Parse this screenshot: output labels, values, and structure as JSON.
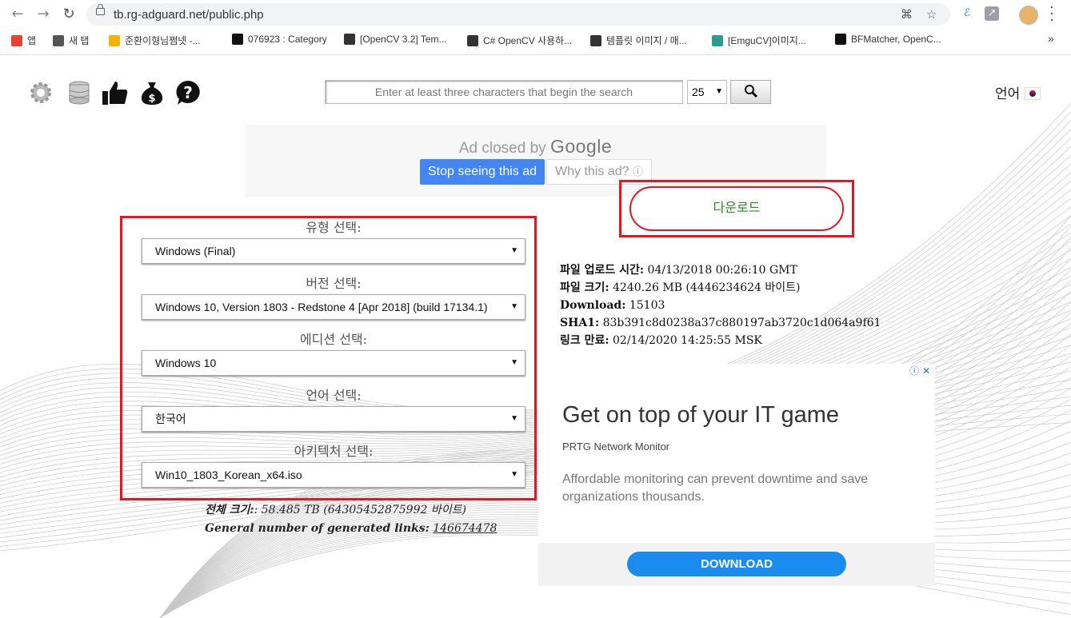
{
  "browser": {
    "url": "tb.rg-adguard.net/public.php",
    "bookmarks": [
      {
        "label": "앱",
        "icon": "apps-grid-icon",
        "color": "#e94235"
      },
      {
        "label": "새 탭",
        "icon": "globe-icon",
        "color": "#555555"
      },
      {
        "label": "준환이형님쩜넷 -...",
        "icon": "star-icon",
        "color": "#f4b400"
      },
      {
        "label": "076923 : Category",
        "icon": "v-logo-icon",
        "color": "#111111"
      },
      {
        "label": "[OpenCV 3.2] Tem...",
        "icon": "dots-logo-icon",
        "color": "#333333"
      },
      {
        "label": "C# OpenCV 사용하...",
        "icon": "dots-logo-icon",
        "color": "#333333"
      },
      {
        "label": "템플릿 이미지 / 매...",
        "icon": "dots-logo-icon",
        "color": "#333333"
      },
      {
        "label": "[EmguCV]이미지...",
        "icon": "c-circle-icon",
        "color": "#2a9d8f"
      },
      {
        "label": "BFMatcher, OpenC...",
        "icon": "csharp-icon",
        "color": "#111111"
      }
    ],
    "more": "»"
  },
  "header": {
    "search_placeholder": "Enter at least three characters that begin the search",
    "per_page": "25",
    "language_label": "언어"
  },
  "ad_top": {
    "closed_text": "Ad closed by",
    "google": "Google",
    "stop_label": "Stop seeing this ad",
    "why_label": "Why this ad?"
  },
  "download_label": "다운로드",
  "selects": [
    {
      "label": "유형 선택:",
      "value": "Windows (Final)"
    },
    {
      "label": "버전 선택:",
      "value": "Windows 10, Version 1803 - Redstone 4 [Apr 2018] (build 17134.1)"
    },
    {
      "label": "에디션 선택:",
      "value": "Windows 10"
    },
    {
      "label": "언어 선택:",
      "value": "한국어"
    },
    {
      "label": "아키텍처 선택:",
      "value": "Win10_1803_Korean_x64.iso"
    }
  ],
  "totals": {
    "size_label": "전체 크기:",
    "size_value": ": 58.485 TB (64305452875992 바이트)",
    "links_label": "General number of generated links:",
    "links_value": "146674478"
  },
  "file_info": [
    {
      "label": "파일 업로드 시간:",
      "value": "04/13/2018 00:26:10 GMT"
    },
    {
      "label": "파일 크기:",
      "value": "4240.26 MB (4446234624 바이트)"
    },
    {
      "label": "Download:",
      "value": "15103"
    },
    {
      "label": "SHA1:",
      "value": "83b391c8d0238a37c880197ab3720c1d064a9f61"
    },
    {
      "label": "링크 만료:",
      "value": "02/14/2020 14:25:55 MSK"
    }
  ],
  "ad_side": {
    "headline": "Get on top of your IT game",
    "sponsor": "PRTG Network Monitor",
    "description": "Affordable monitoring can prevent downtime and save organizations thousands.",
    "cta": "DOWNLOAD",
    "adchoices": "ⓘ ✕"
  },
  "colors": {
    "accent_red": "#e8141f",
    "download_green": "#2a8a2a",
    "google_blue": "#4285f4",
    "cta_blue": "#1a8cf0"
  }
}
